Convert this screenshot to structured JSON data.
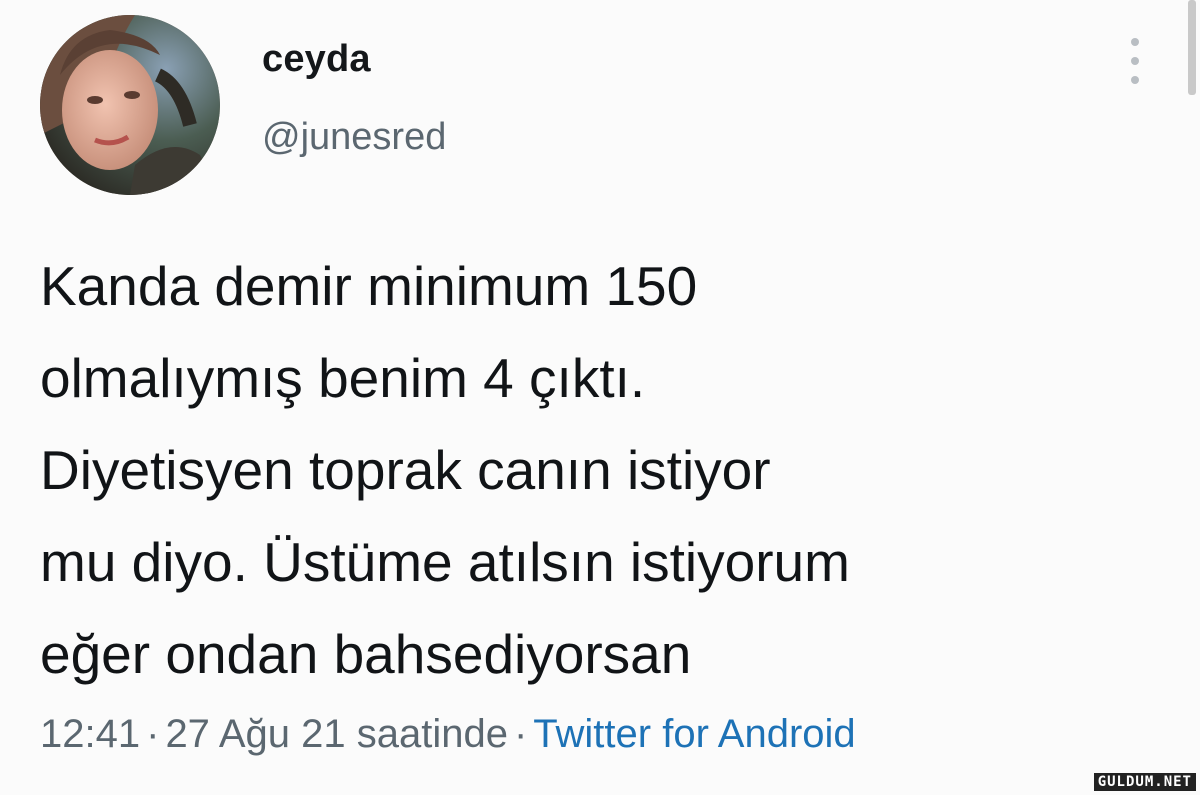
{
  "user": {
    "display_name": "ceyda",
    "handle": "@junesred",
    "avatar_icon": "profile-photo"
  },
  "menu": {
    "icon": "more-vertical-icon"
  },
  "tweet": {
    "lines": [
      "Kanda demir minimum 150",
      "olmalıymış benim 4 çıktı.",
      "Diyetisyen toprak canın istiyor",
      "mu diyo. Üstüme atılsın istiyorum",
      "eğer ondan bahsediyorsan"
    ]
  },
  "meta": {
    "time": "12:41",
    "separator": "·",
    "date": "27 Ağu 21 saatinde",
    "source": "Twitter for Android"
  },
  "watermark": "GULDUM.NET",
  "colors": {
    "background": "#fbfbfb",
    "text": "#111417",
    "secondary": "#5b6770",
    "link": "#1d72b6"
  }
}
